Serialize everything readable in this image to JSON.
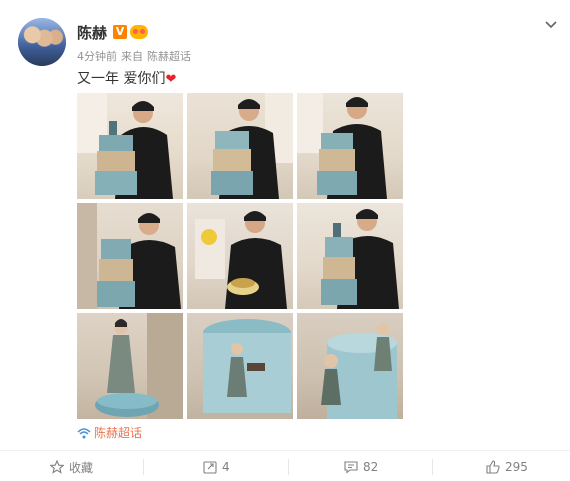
{
  "post": {
    "author": "陈赫",
    "time": "4分钟前",
    "source_prefix": "来自",
    "source": "陈赫超话",
    "text": "又一年 爱你们",
    "topic": "陈赫超话"
  },
  "actions": {
    "favorite": "收藏",
    "repost": "4",
    "comment": "82",
    "like": "295"
  },
  "colors": {
    "accent": "#eb7350",
    "verified": "#ff8200",
    "heart": "#e8212b"
  },
  "icons": [
    "chevron-down-icon",
    "verified-v-icon",
    "fan-badge-icon",
    "heart-icon",
    "topic-icon",
    "star-icon",
    "repost-icon",
    "comment-icon",
    "like-icon"
  ],
  "photos": [
    "photo-man-with-tiered-cake",
    "photo-man-behind-cake",
    "photo-man-smiling-with-cake",
    "photo-man-leaning-by-cake",
    "photo-man-cutting-small-cake",
    "photo-man-beside-tall-cake",
    "photo-figurine-standing",
    "photo-cake-figurine-closeup",
    "photo-cake-figurines-side"
  ]
}
